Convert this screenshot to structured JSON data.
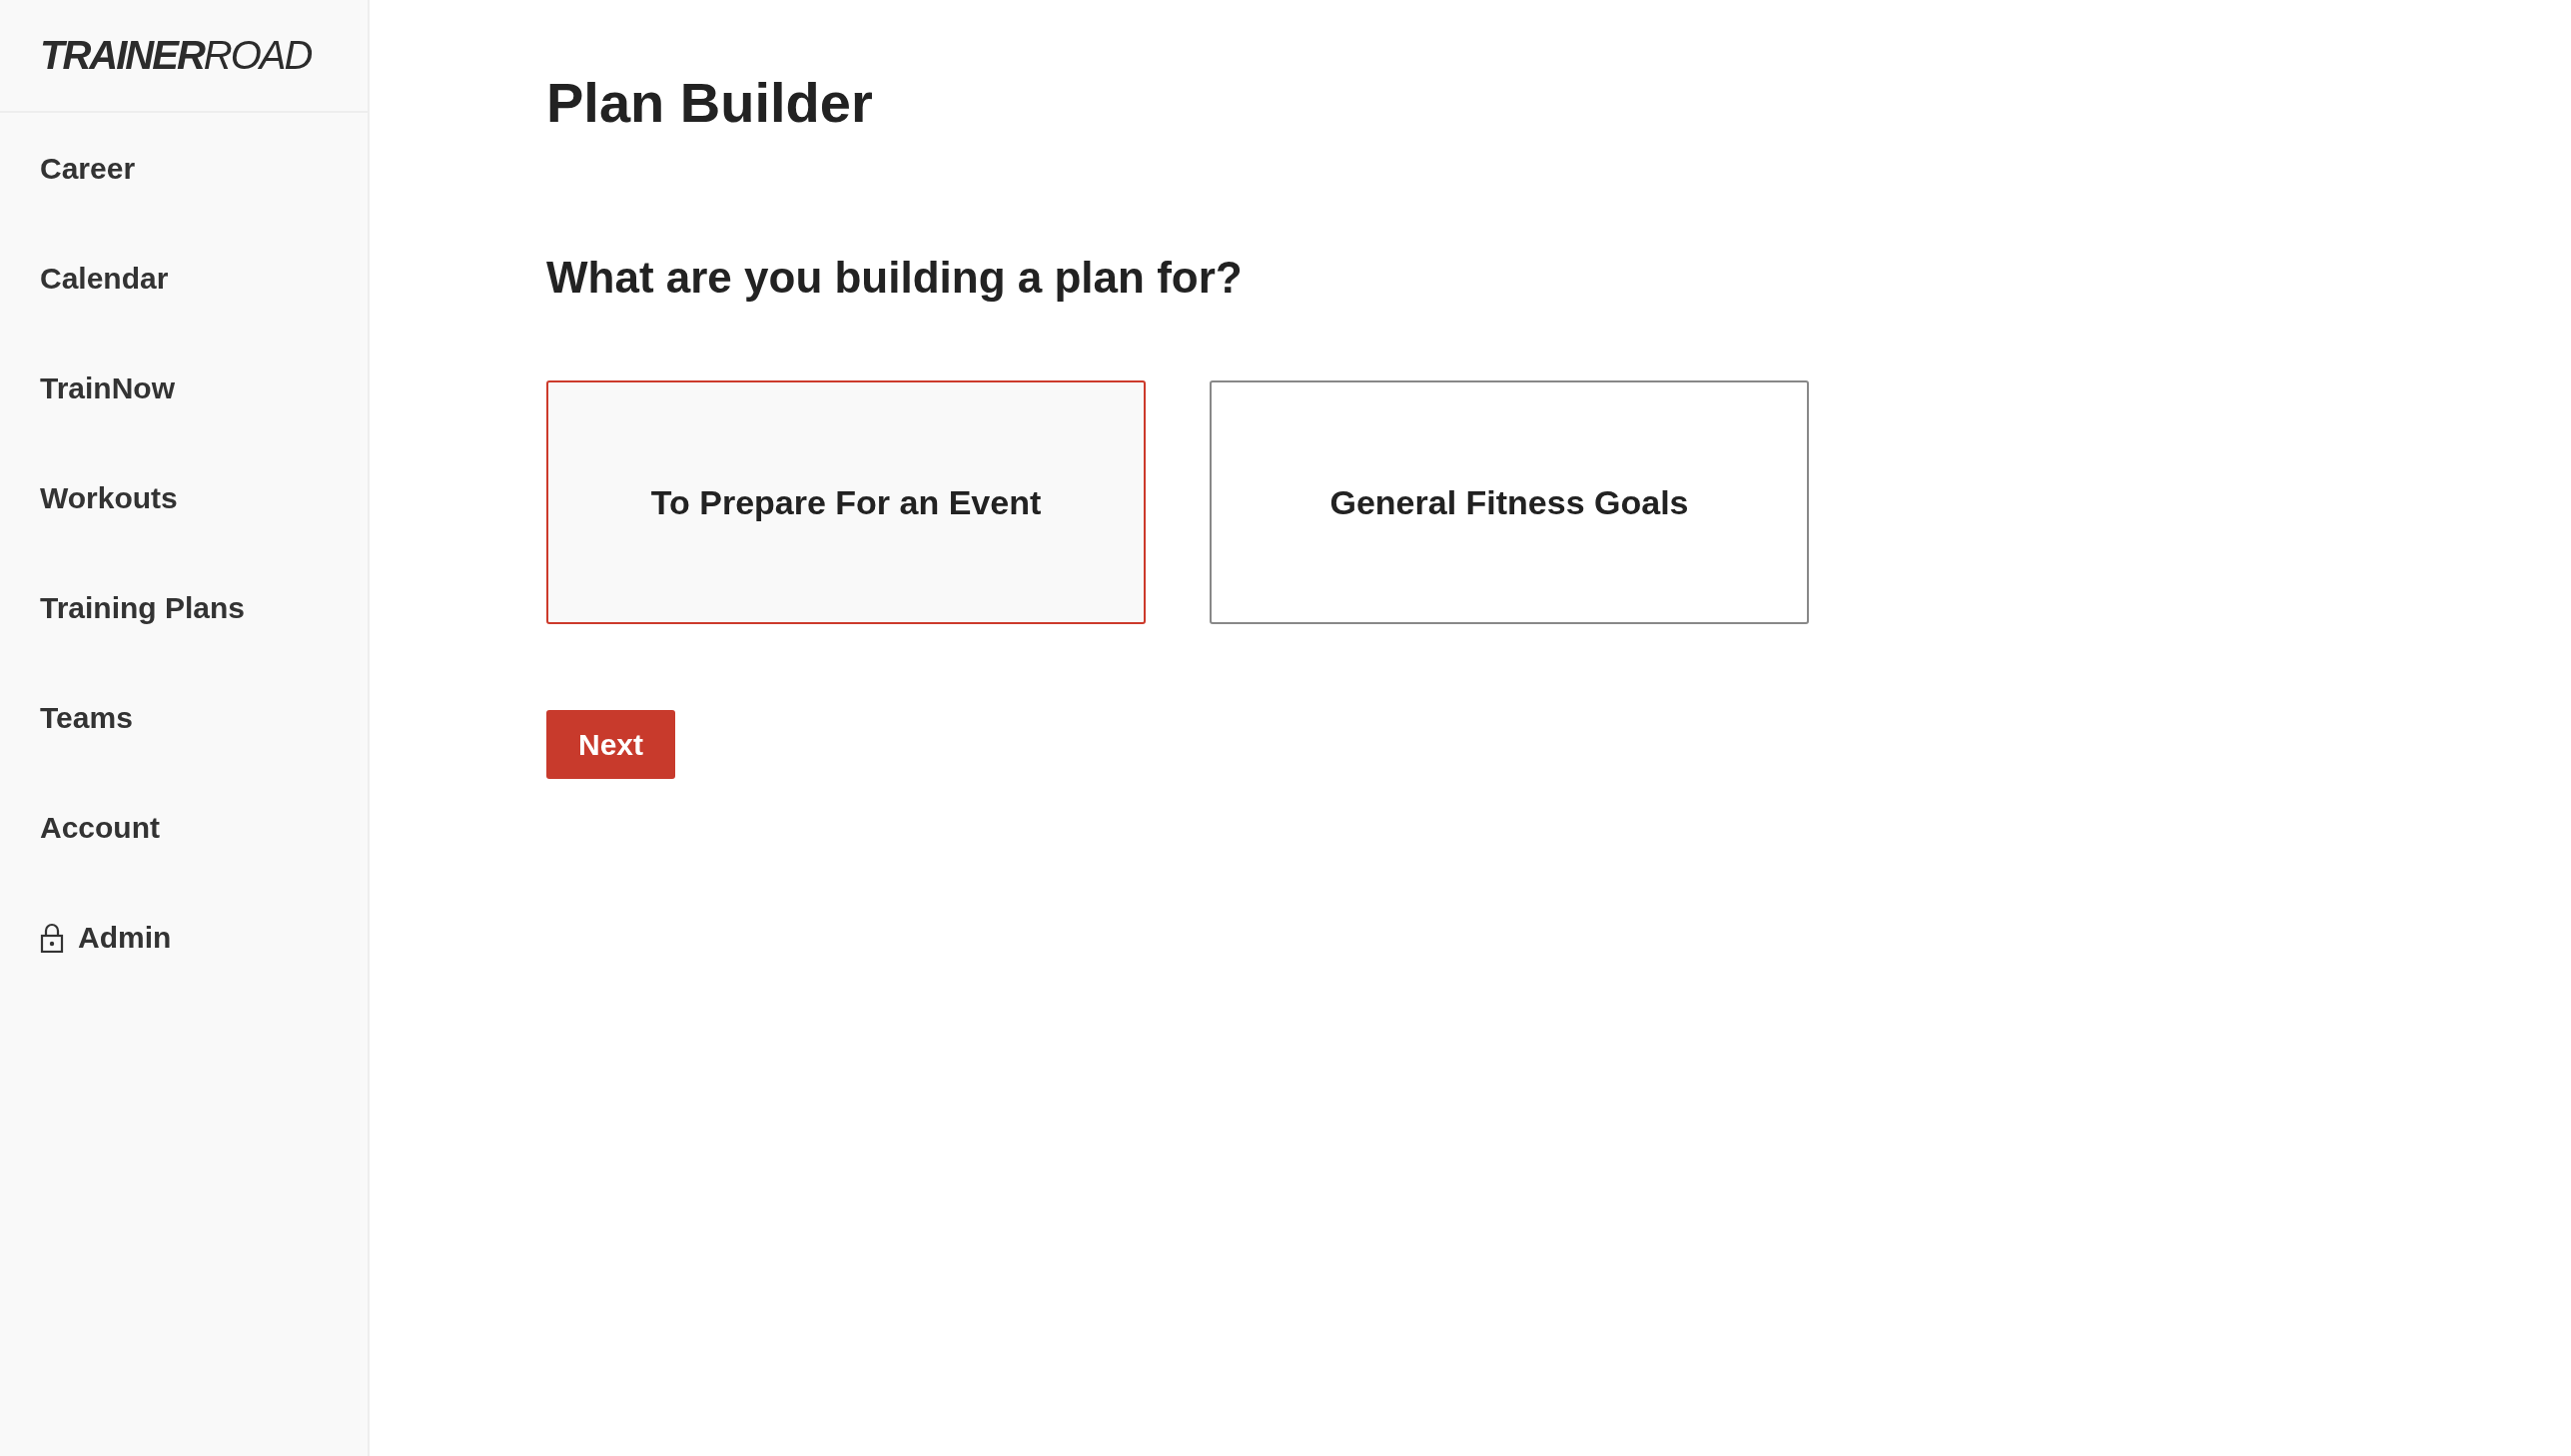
{
  "sidebar": {
    "logo": "**TRAINER**ROAD",
    "items": [
      {
        "label": "Career",
        "kind": "plain"
      },
      {
        "label": "Calendar",
        "kind": "plain"
      },
      {
        "label": "TrainNow",
        "kind": "plain"
      },
      {
        "label": "Workouts",
        "kind": "plain"
      },
      {
        "label": "Training Plans",
        "kind": "plain"
      },
      {
        "label": "Teams",
        "kind": "plain"
      },
      {
        "label": "Account",
        "kind": "plain"
      },
      {
        "label": "Admin",
        "kind": "locked"
      }
    ]
  },
  "page": {
    "title": "Plan Builder",
    "question": "What are you building a plan for?",
    "options": [
      {
        "label": "To Prepare For an Event",
        "selected": true
      },
      {
        "label": "General Fitness Goals",
        "selected": false
      }
    ],
    "next_button": "Next"
  }
}
